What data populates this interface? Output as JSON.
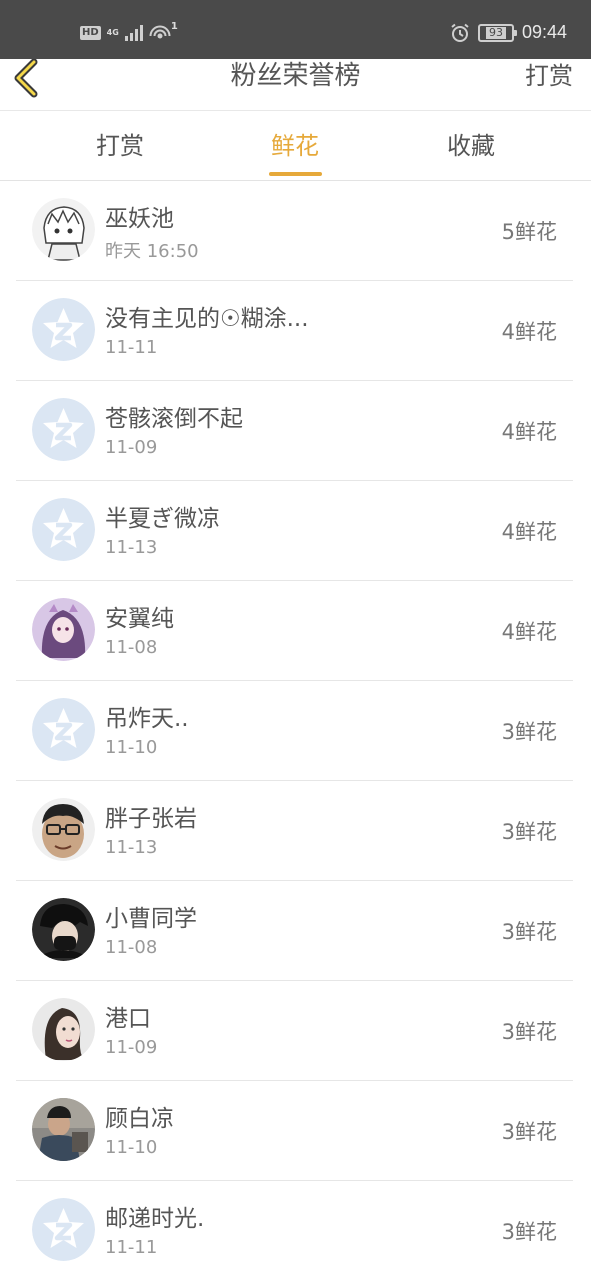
{
  "status_bar": {
    "hd": "HD",
    "network": "4G",
    "wifi_superscript": "1",
    "battery": "93",
    "time": "09:44"
  },
  "header": {
    "title": "粉丝荣誉榜",
    "right_button": "打赏"
  },
  "tabs": [
    {
      "label": "打赏"
    },
    {
      "label": "鲜花"
    },
    {
      "label": "收藏"
    }
  ],
  "active_tab": "鲜花",
  "colors": {
    "accent": "#e6a93a",
    "status_bar": "#4a4a4a",
    "default_avatar": "#dbe6f3"
  },
  "fans": [
    {
      "name": "巫妖池",
      "date": "昨天 16:50",
      "flowers": "5鲜花",
      "avatar": "anime-sketch-avatar"
    },
    {
      "name": "没有主见的☉糊涂...",
      "date": "11-11",
      "flowers": "4鲜花",
      "avatar": "default-qq-avatar"
    },
    {
      "name": "苍骸滚倒不起",
      "date": "11-09",
      "flowers": "4鲜花",
      "avatar": "default-qq-avatar"
    },
    {
      "name": "半夏ぎ微凉",
      "date": "11-13",
      "flowers": "4鲜花",
      "avatar": "default-qq-avatar"
    },
    {
      "name": "安翼纯",
      "date": "11-08",
      "flowers": "4鲜花",
      "avatar": "anime-girl-avatar"
    },
    {
      "name": "吊炸天..",
      "date": "11-10",
      "flowers": "3鲜花",
      "avatar": "default-qq-avatar"
    },
    {
      "name": "胖子张岩",
      "date": "11-13",
      "flowers": "3鲜花",
      "avatar": "man-glasses-avatar"
    },
    {
      "name": "小曹同学",
      "date": "11-08",
      "flowers": "3鲜花",
      "avatar": "masked-person-avatar"
    },
    {
      "name": "港口",
      "date": "11-09",
      "flowers": "3鲜花",
      "avatar": "long-hair-avatar"
    },
    {
      "name": "顾白凉",
      "date": "11-10",
      "flowers": "3鲜花",
      "avatar": "photo-person-avatar"
    },
    {
      "name": "邮递时光.",
      "date": "11-11",
      "flowers": "3鲜花",
      "avatar": "default-qq-avatar"
    }
  ]
}
